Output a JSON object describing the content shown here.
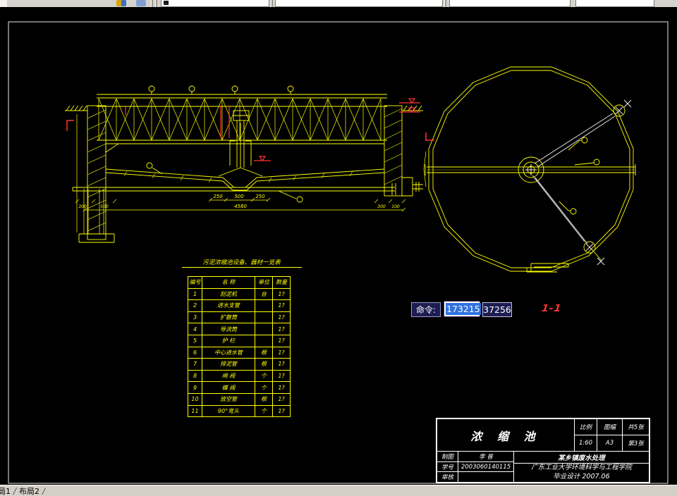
{
  "app": {
    "tabs": [
      "局1",
      "布局2"
    ],
    "command": {
      "label": "命令:",
      "value_x": "173215",
      "value_y": "37256"
    }
  },
  "section_view": {
    "label": "1-1",
    "dims": {
      "a": "250",
      "b": "500",
      "c": "250",
      "total": "4580",
      "bl1": "300",
      "bl2": "500",
      "br1": "300",
      "br2": "100"
    }
  },
  "materials_table": {
    "title": "污泥浓缩池设备、器材一览表",
    "headers": [
      "编号",
      "名 称",
      "单位",
      "数量"
    ],
    "rows": [
      {
        "no": "1",
        "name": "刮泥机",
        "unit": "台",
        "qty": "1?"
      },
      {
        "no": "2",
        "name": "进水支管",
        "unit": "",
        "qty": "1?"
      },
      {
        "no": "3",
        "name": "扩散筒",
        "unit": "",
        "qty": "1?"
      },
      {
        "no": "4",
        "name": "导流筒",
        "unit": "",
        "qty": "1?"
      },
      {
        "no": "5",
        "name": "护 栏",
        "unit": "",
        "qty": "1?"
      },
      {
        "no": "6",
        "name": "中心进水管",
        "unit": "根",
        "qty": "1?"
      },
      {
        "no": "7",
        "name": "排泥管",
        "unit": "根",
        "qty": "1?"
      },
      {
        "no": "8",
        "name": "闸 阀",
        "unit": "个",
        "qty": "1?"
      },
      {
        "no": "9",
        "name": "蝶 阀",
        "unit": "个",
        "qty": "1?"
      },
      {
        "no": "10",
        "name": "放空管",
        "unit": "根",
        "qty": "1?"
      },
      {
        "no": "11",
        "name": "90°弯头",
        "unit": "个",
        "qty": "1?"
      }
    ]
  },
  "title_block": {
    "title": "浓 缩 池",
    "scale_label": "比例",
    "scale": "1:60",
    "format_label": "图幅",
    "format": "A3",
    "sheets_label": "共5张",
    "sheet_no": "第3张",
    "drafter_label": "制图",
    "drafter": "李 普",
    "student_label": "学号",
    "student_id": "2003060140115",
    "checker_label": "审核",
    "checker": "",
    "project": "某乡镇废水处理",
    "school": "广东工业大学环境科学与工程学院",
    "footer": "毕业设计    2007.06"
  },
  "colors": {
    "drawing_line": "#ffff00",
    "white_line": "#e8e8e8",
    "highlight_red": "#ff3434",
    "selection_blue": "#2f72e0",
    "cmd_box_bg": "#1d1d52",
    "ui_gray": "#d4d0c8"
  }
}
